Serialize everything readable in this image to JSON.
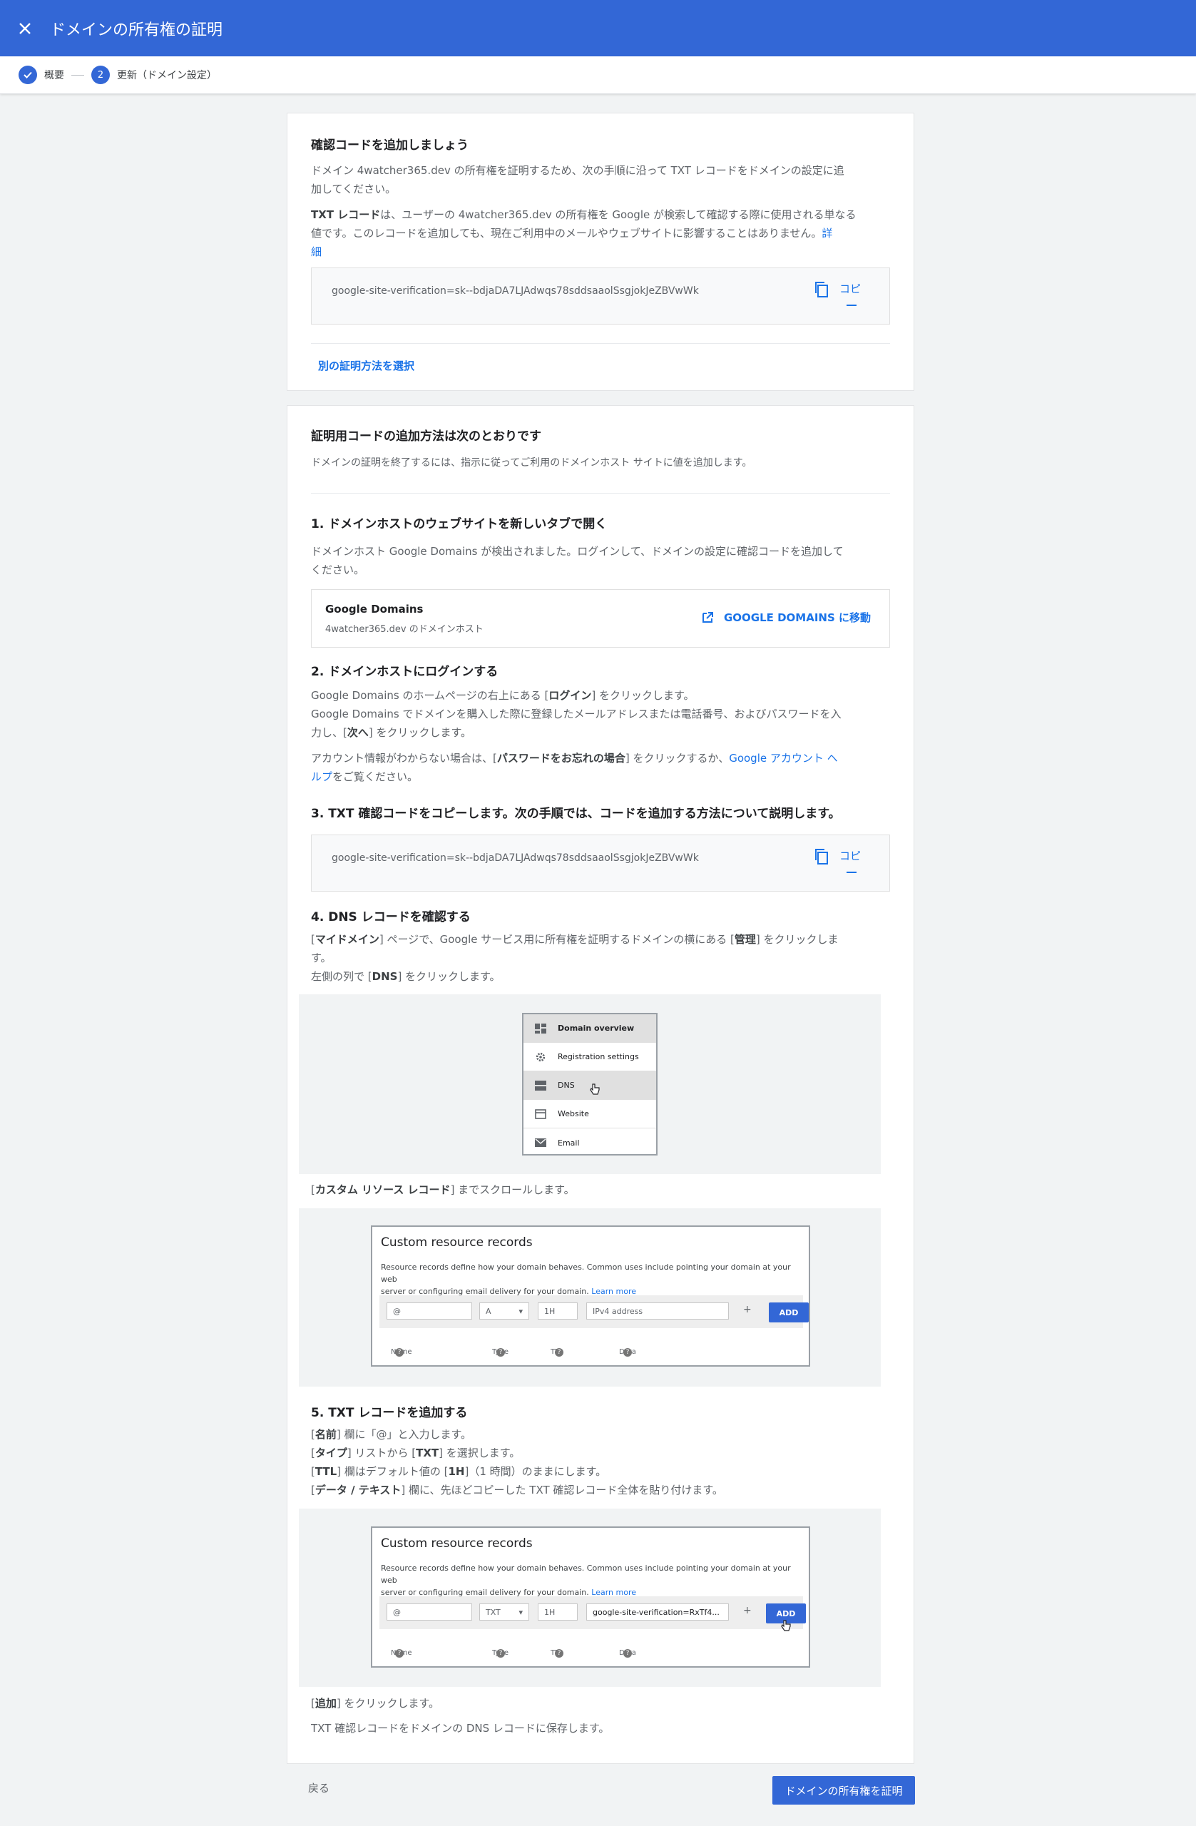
{
  "header": {
    "title": "ドメインの所有権の証明",
    "close_icon": "close-icon"
  },
  "stepper": {
    "step1_label": "概要",
    "step2_number": "2",
    "step2_label": "更新（ドメイン設定）"
  },
  "card1": {
    "heading": "確認コードを追加しましょう",
    "intro_line1": "ドメイン 4watcher365.dev の所有権を証明するため、次の手順に沿って TXT レコードをドメインの設定に追",
    "intro_line2": "加してください。",
    "txt_bold": "TXT レコード",
    "txt_line1": "は、ユーザーの 4watcher365.dev の所有権を Google が検索して確認する際に使用される単なる",
    "txt_line2": "値です。このレコードを追加しても、現在ご利用中のメールやウェブサイトに影響することはありません。",
    "learn_more_1": "詳",
    "learn_more_2": "細",
    "code": "google-site-verification=sk--bdjaDA7LJAdwqs78sddsaaolSsgjokJeZBVwWk",
    "copy_label": "コピ",
    "alt_method": "別の証明方法を選択"
  },
  "card2": {
    "heading": "証明用コードの追加方法は次のとおりです",
    "intro": "ドメインの証明を終了するには、指示に従ってご利用のドメインホスト サイトに値を追加します。",
    "step1": {
      "heading": "1. ドメインホストのウェブサイトを新しいタブで開く",
      "line1": "ドメインホスト Google Domains が検出されました。ログインして、ドメインの設定に確認コードを追加して",
      "line2": "ください。",
      "host_name": "Google Domains",
      "host_sub": "4watcher365.dev のドメインホスト",
      "goto_label": "GOOGLE DOMAINS に移動"
    },
    "step2": {
      "heading": "2. ドメインホストにログインする",
      "l1a": "Google Domains のホームページの右上にある [",
      "l1b": "ログイン",
      "l1c": "] をクリックします。",
      "l2": "Google Domains でドメインを購入した際に登録したメールアドレスまたは電話番号、およびパスワードを入",
      "l3a": "力し、[",
      "l3b": "次へ",
      "l3c": "] をクリックします。",
      "l4a": "アカウント情報がわからない場合は、[",
      "l4b": "パスワードをお忘れの場合",
      "l4c": "] をクリックするか、",
      "l4d": "Google アカウント ヘ",
      "l5a": "ルプ",
      "l5b": "をご覧ください。"
    },
    "step3": {
      "heading": "3. TXT 確認コードをコピーします。次の手順では、コードを追加する方法について説明します。",
      "code": "google-site-verification=sk--bdjaDA7LJAdwqs78sddsaaolSsgjokJeZBVwWk",
      "copy_label": "コピ"
    },
    "step4": {
      "heading": "4. DNS レコードを確認する",
      "l1a": "[",
      "l1b": "マイドメイン",
      "l1c": "] ページで、Google サービス用に所有権を証明するドメインの横にある [",
      "l1d": "管理",
      "l1e": "] をクリックしま",
      "l2": "す。",
      "l3a": "左側の列で [",
      "l3b": "DNS",
      "l3c": "] をクリックします。",
      "menu": [
        "Domain overview",
        "Registration settings",
        "DNS",
        "Website",
        "Email"
      ],
      "scroll_a": "[",
      "scroll_b": "カスタム リソース レコード",
      "scroll_c": "] までスクロールします。"
    },
    "crr1": {
      "title": "Custom resource records",
      "desc1": "Resource records define how your domain behaves. Common uses include pointing your domain at your web",
      "desc2": "server or configuring email delivery for your domain.",
      "learn": "Learn more",
      "f_name": "@",
      "f_type": "A",
      "f_ttl": "1H",
      "f_data": "IPv4 address",
      "add": "ADD",
      "h_name": "Name",
      "h_type": "Type",
      "h_ttl": "TTL",
      "h_data": "Data"
    },
    "step5": {
      "heading": "5. TXT レコードを追加する",
      "l1a": "[",
      "l1b": "名前",
      "l1c": "] 欄に「@」と入力します。",
      "l2a": "[",
      "l2b": "タイプ",
      "l2c": "] リストから [",
      "l2d": "TXT",
      "l2e": "] を選択します。",
      "l3a": "[",
      "l3b": "TTL",
      "l3c": "] 欄はデフォルト値の [",
      "l3d": "1H",
      "l3e": "]（1 時間）のままにします。",
      "l4a": "[",
      "l4b": "データ / テキスト",
      "l4c": "] 欄に、先ほどコピーした TXT 確認レコード全体を貼り付けます。",
      "click_a": "[",
      "click_b": "追加",
      "click_c": "] をクリックします。",
      "save": "TXT 確認レコードをドメインの DNS レコードに保存します。"
    },
    "crr2": {
      "title": "Custom resource records",
      "desc1": "Resource records define how your domain behaves. Common uses include pointing your domain at your web",
      "desc2": "server or configuring email delivery for your domain.",
      "learn": "Learn more",
      "f_name": "@",
      "f_type": "TXT",
      "f_ttl": "1H",
      "f_data": "google-site-verification=RxTf4...",
      "add": "ADD",
      "h_name": "Name",
      "h_type": "Type",
      "h_ttl": "TTL",
      "h_data": "Data"
    }
  },
  "footer": {
    "back": "戻る",
    "verify": "ドメインの所有権を証明"
  }
}
